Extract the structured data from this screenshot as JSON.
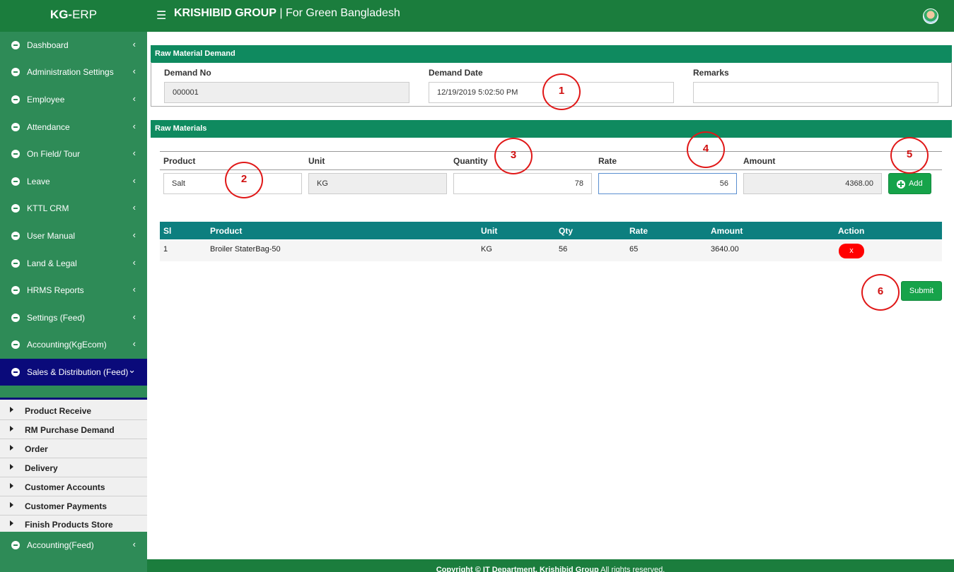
{
  "topbar": {
    "brand_bold": "KG-",
    "brand_rest": "ERP",
    "menu_icon": "☰",
    "company_bold": "KRISHIBID GROUP",
    "company_rest": " | For Green Bangladesh",
    "avatar_icon": "user-avatar"
  },
  "sidebar": {
    "items": [
      {
        "label": "Dashboard"
      },
      {
        "label": "Administration Settings"
      },
      {
        "label": "Employee"
      },
      {
        "label": "Attendance"
      },
      {
        "label": "On Field/ Tour"
      },
      {
        "label": "Leave"
      },
      {
        "label": "KTTL CRM"
      },
      {
        "label": "User Manual"
      },
      {
        "label": "Land & Legal"
      },
      {
        "label": "HRMS Reports"
      },
      {
        "label": "Settings (Feed)"
      },
      {
        "label": "Accounting(KgEcom)"
      },
      {
        "label": "Sales & Distribution (Feed)"
      },
      {
        "label": "Accounting(Feed)"
      }
    ],
    "submenu": [
      {
        "label": "Product Receive"
      },
      {
        "label": "RM Purchase Demand"
      },
      {
        "label": "Order"
      },
      {
        "label": "Delivery"
      },
      {
        "label": "Customer Accounts"
      },
      {
        "label": "Customer Payments"
      },
      {
        "label": "Finish Products Store"
      }
    ],
    "chevron_left": "‹",
    "chevron_down": "⌄"
  },
  "demand": {
    "title": "Raw Material Demand",
    "demand_no_label": "Demand No",
    "demand_no_value": "000001",
    "demand_date_label": "Demand Date",
    "demand_date_value": "12/19/2019 5:02:50 PM",
    "remarks_label": "Remarks",
    "remarks_value": ""
  },
  "materials": {
    "title": "Raw Materials",
    "product_label": "Product",
    "product_value": "Salt",
    "unit_label": "Unit",
    "unit_value": "KG",
    "quantity_label": "Quantity",
    "quantity_value": "78",
    "rate_label": "Rate",
    "rate_value": "56",
    "amount_label": "Amount",
    "amount_value": "4368.00",
    "add_label": "Add"
  },
  "table": {
    "headers": [
      "Sl",
      "Product",
      "Unit",
      "Qty",
      "Rate",
      "Amount",
      "Action"
    ],
    "rows": [
      {
        "sl": "1",
        "product": "Broiler StaterBag-50",
        "unit": "KG",
        "qty": "56",
        "rate": "65",
        "amount": "3640.00",
        "action": "x"
      }
    ]
  },
  "submit_label": "Submit",
  "annotations": [
    "1",
    "2",
    "3",
    "4",
    "5",
    "6"
  ],
  "footer": {
    "bold": "Copyright © IT Department, Krishibid Group",
    "rest": " All rights reserved."
  },
  "colors": {
    "topbar": "#1b7d3d",
    "sidebar": "#2e8b57",
    "active": "#0a0a7a",
    "panel_header": "#0f8a5f",
    "table_header": "#0d7f7f",
    "button_green": "#16a34a",
    "annotation_red": "#e01818"
  }
}
